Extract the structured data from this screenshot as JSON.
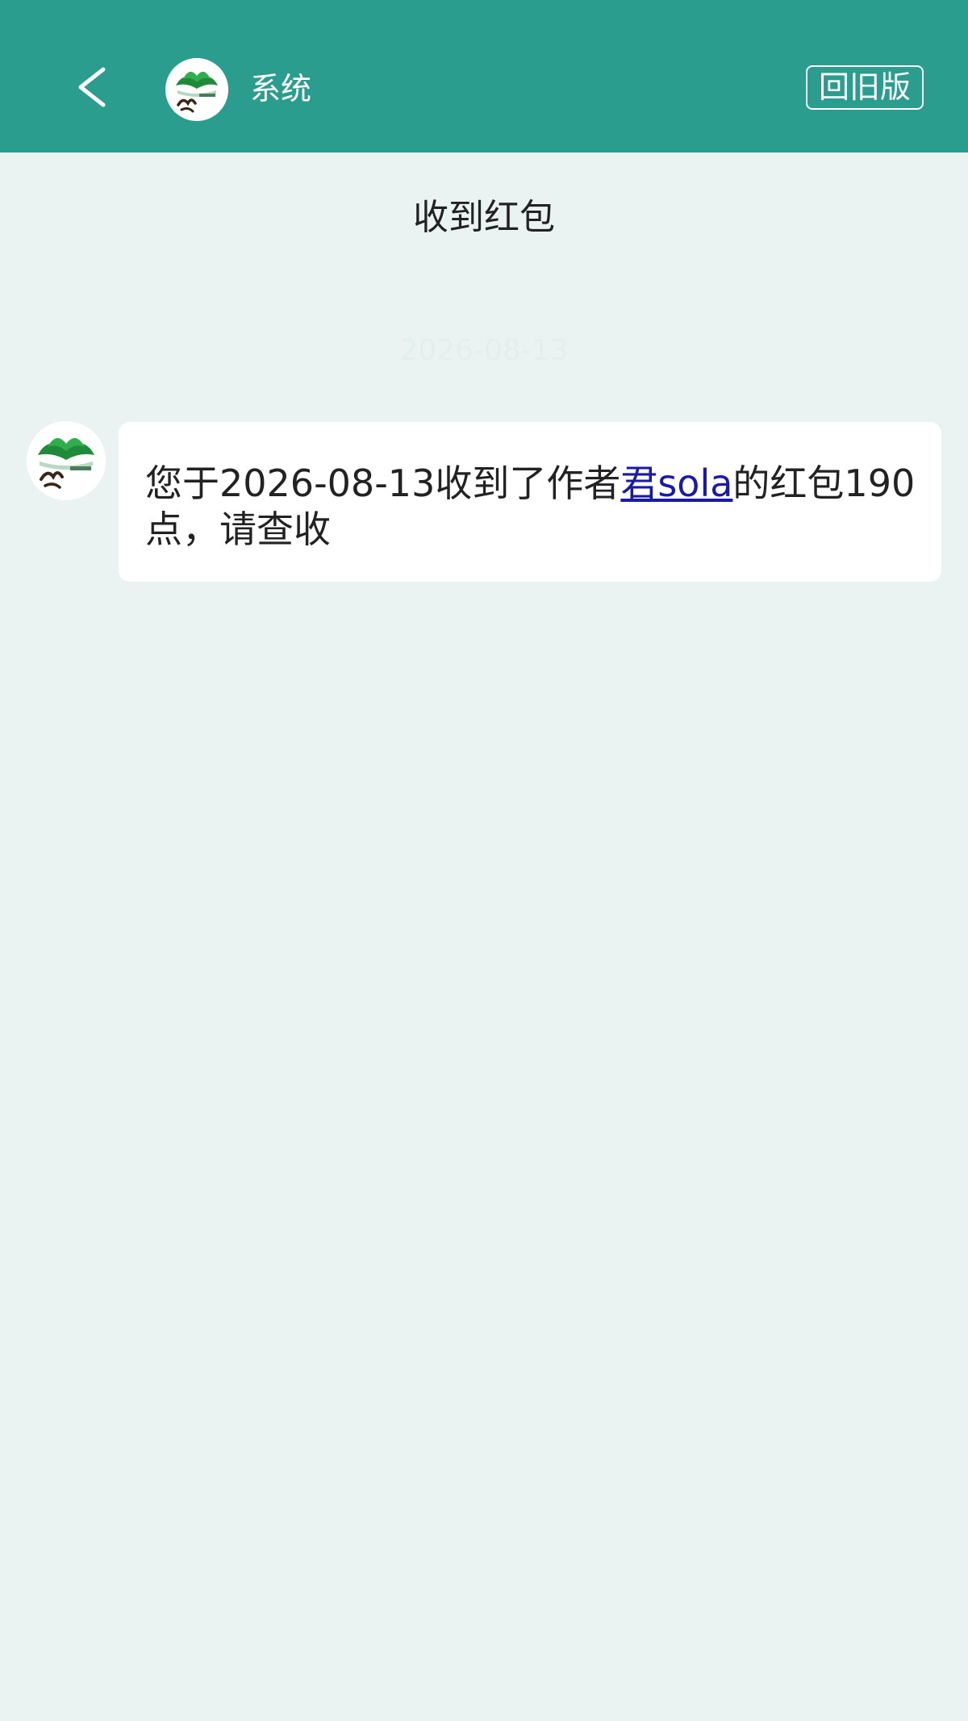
{
  "header": {
    "back_icon": "chevron-left-icon",
    "avatar_icon": "jjwxc-logo",
    "title": "系统",
    "old_version_label": "回旧版"
  },
  "page": {
    "title": "收到红包",
    "faint_timestamp": "2026-08-13"
  },
  "message": {
    "avatar_icon": "jjwxc-logo",
    "text_before": "您于2026-08-13收到了作者",
    "author_link": "君sola",
    "text_after": "的红包190点，请查收"
  },
  "colors": {
    "header_bg": "#2a9d8f",
    "page_bg": "#eaf3f1",
    "link": "#1a1aa8"
  }
}
